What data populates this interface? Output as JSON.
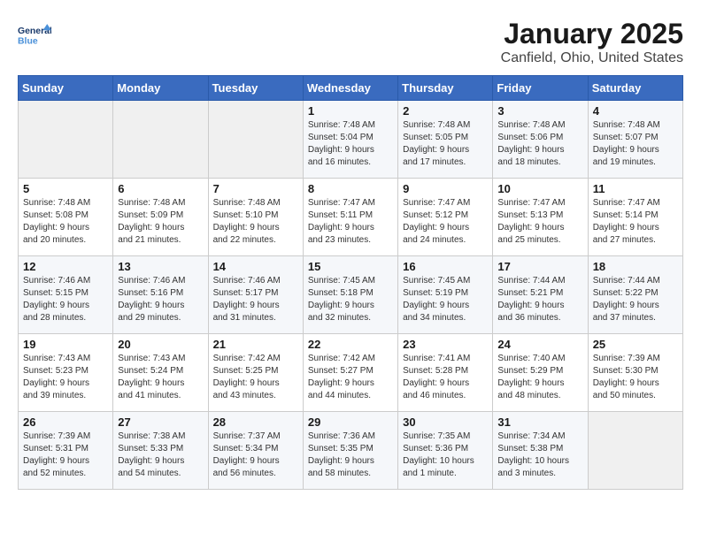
{
  "header": {
    "logo_line1": "General",
    "logo_line2": "Blue",
    "month": "January 2025",
    "location": "Canfield, Ohio, United States"
  },
  "weekdays": [
    "Sunday",
    "Monday",
    "Tuesday",
    "Wednesday",
    "Thursday",
    "Friday",
    "Saturday"
  ],
  "weeks": [
    [
      {
        "day": "",
        "info": ""
      },
      {
        "day": "",
        "info": ""
      },
      {
        "day": "",
        "info": ""
      },
      {
        "day": "1",
        "info": "Sunrise: 7:48 AM\nSunset: 5:04 PM\nDaylight: 9 hours\nand 16 minutes."
      },
      {
        "day": "2",
        "info": "Sunrise: 7:48 AM\nSunset: 5:05 PM\nDaylight: 9 hours\nand 17 minutes."
      },
      {
        "day": "3",
        "info": "Sunrise: 7:48 AM\nSunset: 5:06 PM\nDaylight: 9 hours\nand 18 minutes."
      },
      {
        "day": "4",
        "info": "Sunrise: 7:48 AM\nSunset: 5:07 PM\nDaylight: 9 hours\nand 19 minutes."
      }
    ],
    [
      {
        "day": "5",
        "info": "Sunrise: 7:48 AM\nSunset: 5:08 PM\nDaylight: 9 hours\nand 20 minutes."
      },
      {
        "day": "6",
        "info": "Sunrise: 7:48 AM\nSunset: 5:09 PM\nDaylight: 9 hours\nand 21 minutes."
      },
      {
        "day": "7",
        "info": "Sunrise: 7:48 AM\nSunset: 5:10 PM\nDaylight: 9 hours\nand 22 minutes."
      },
      {
        "day": "8",
        "info": "Sunrise: 7:47 AM\nSunset: 5:11 PM\nDaylight: 9 hours\nand 23 minutes."
      },
      {
        "day": "9",
        "info": "Sunrise: 7:47 AM\nSunset: 5:12 PM\nDaylight: 9 hours\nand 24 minutes."
      },
      {
        "day": "10",
        "info": "Sunrise: 7:47 AM\nSunset: 5:13 PM\nDaylight: 9 hours\nand 25 minutes."
      },
      {
        "day": "11",
        "info": "Sunrise: 7:47 AM\nSunset: 5:14 PM\nDaylight: 9 hours\nand 27 minutes."
      }
    ],
    [
      {
        "day": "12",
        "info": "Sunrise: 7:46 AM\nSunset: 5:15 PM\nDaylight: 9 hours\nand 28 minutes."
      },
      {
        "day": "13",
        "info": "Sunrise: 7:46 AM\nSunset: 5:16 PM\nDaylight: 9 hours\nand 29 minutes."
      },
      {
        "day": "14",
        "info": "Sunrise: 7:46 AM\nSunset: 5:17 PM\nDaylight: 9 hours\nand 31 minutes."
      },
      {
        "day": "15",
        "info": "Sunrise: 7:45 AM\nSunset: 5:18 PM\nDaylight: 9 hours\nand 32 minutes."
      },
      {
        "day": "16",
        "info": "Sunrise: 7:45 AM\nSunset: 5:19 PM\nDaylight: 9 hours\nand 34 minutes."
      },
      {
        "day": "17",
        "info": "Sunrise: 7:44 AM\nSunset: 5:21 PM\nDaylight: 9 hours\nand 36 minutes."
      },
      {
        "day": "18",
        "info": "Sunrise: 7:44 AM\nSunset: 5:22 PM\nDaylight: 9 hours\nand 37 minutes."
      }
    ],
    [
      {
        "day": "19",
        "info": "Sunrise: 7:43 AM\nSunset: 5:23 PM\nDaylight: 9 hours\nand 39 minutes."
      },
      {
        "day": "20",
        "info": "Sunrise: 7:43 AM\nSunset: 5:24 PM\nDaylight: 9 hours\nand 41 minutes."
      },
      {
        "day": "21",
        "info": "Sunrise: 7:42 AM\nSunset: 5:25 PM\nDaylight: 9 hours\nand 43 minutes."
      },
      {
        "day": "22",
        "info": "Sunrise: 7:42 AM\nSunset: 5:27 PM\nDaylight: 9 hours\nand 44 minutes."
      },
      {
        "day": "23",
        "info": "Sunrise: 7:41 AM\nSunset: 5:28 PM\nDaylight: 9 hours\nand 46 minutes."
      },
      {
        "day": "24",
        "info": "Sunrise: 7:40 AM\nSunset: 5:29 PM\nDaylight: 9 hours\nand 48 minutes."
      },
      {
        "day": "25",
        "info": "Sunrise: 7:39 AM\nSunset: 5:30 PM\nDaylight: 9 hours\nand 50 minutes."
      }
    ],
    [
      {
        "day": "26",
        "info": "Sunrise: 7:39 AM\nSunset: 5:31 PM\nDaylight: 9 hours\nand 52 minutes."
      },
      {
        "day": "27",
        "info": "Sunrise: 7:38 AM\nSunset: 5:33 PM\nDaylight: 9 hours\nand 54 minutes."
      },
      {
        "day": "28",
        "info": "Sunrise: 7:37 AM\nSunset: 5:34 PM\nDaylight: 9 hours\nand 56 minutes."
      },
      {
        "day": "29",
        "info": "Sunrise: 7:36 AM\nSunset: 5:35 PM\nDaylight: 9 hours\nand 58 minutes."
      },
      {
        "day": "30",
        "info": "Sunrise: 7:35 AM\nSunset: 5:36 PM\nDaylight: 10 hours\nand 1 minute."
      },
      {
        "day": "31",
        "info": "Sunrise: 7:34 AM\nSunset: 5:38 PM\nDaylight: 10 hours\nand 3 minutes."
      },
      {
        "day": "",
        "info": ""
      }
    ]
  ]
}
